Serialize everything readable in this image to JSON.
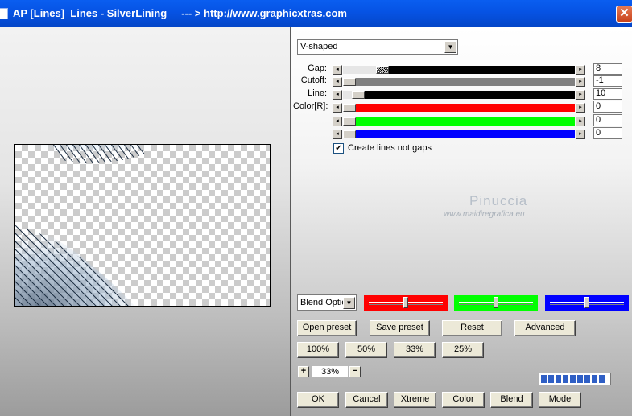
{
  "window": {
    "title": "AP [Lines]  Lines - SilverLining     --- > http://www.graphicxtras.com",
    "close_glyph": "✕"
  },
  "mode_select": {
    "value": "V-shaped"
  },
  "sliders": [
    {
      "label": "Gap:",
      "value": "8",
      "fill": "#000000",
      "position": 0.15,
      "thumb": "checker"
    },
    {
      "label": "Cutoff:",
      "value": "-1",
      "fill": "#808080",
      "position": 0.0,
      "thumb": "plain"
    },
    {
      "label": "Line:",
      "value": "10",
      "fill": "#000000",
      "position": 0.04,
      "thumb": "plain"
    },
    {
      "label": "Color[R]:",
      "value": "0",
      "fill": "#ff0000",
      "position": 0.0,
      "thumb": "plain"
    },
    {
      "label": "",
      "value": "0",
      "fill": "#00ff00",
      "position": 0.0,
      "thumb": "plain"
    },
    {
      "label": "",
      "value": "0",
      "fill": "#0000ff",
      "position": 0.0,
      "thumb": "plain"
    }
  ],
  "checkbox": {
    "label": "Create lines not gaps",
    "checked": true
  },
  "watermark": {
    "name": "Pinuccia",
    "url": "www.maidiregrafica.eu"
  },
  "blend_select": {
    "value": "Blend Options"
  },
  "color_controls": [
    {
      "color": "#ff0000",
      "position": 0.5
    },
    {
      "color": "#00ff00",
      "position": 0.5
    },
    {
      "color": "#0000ff",
      "position": 0.5
    }
  ],
  "buttons": {
    "open_preset": "Open preset",
    "save_preset": "Save preset",
    "reset": "Reset",
    "advanced": "Advanced",
    "zoom_100": "100%",
    "zoom_50": "50%",
    "zoom_33": "33%",
    "zoom_25": "25%",
    "ok": "OK",
    "cancel": "Cancel",
    "xtreme": "Xtreme",
    "color": "Color",
    "blend": "Blend",
    "mode": "Mode"
  },
  "zoom": {
    "plus": "+",
    "value": "33%",
    "minus": "−"
  },
  "progress": {
    "segments": 9,
    "fraction": 1.0
  }
}
